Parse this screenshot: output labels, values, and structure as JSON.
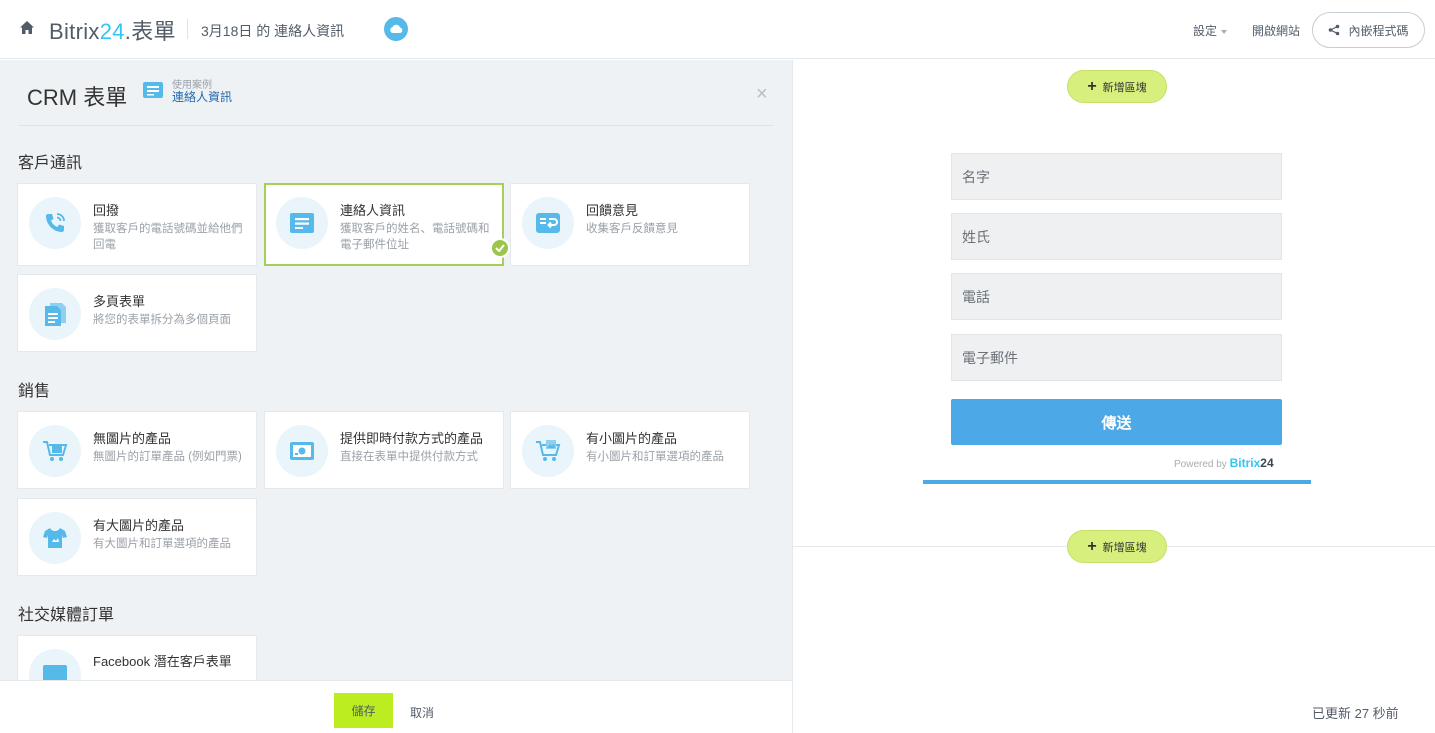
{
  "header": {
    "brand_name": "Bitrix",
    "brand_num": "24",
    "brand_suffix": ".表單",
    "breadcrumb": "3月18日 的 連絡人資訊",
    "settings_label": "設定",
    "open_site_label": "開啟網站",
    "embed_label": "內嵌程式碼"
  },
  "left": {
    "title": "CRM 表單",
    "use_case_label": "使用案例",
    "use_case_value": "連絡人資訊",
    "close_glyph": "×",
    "sections": [
      {
        "title": "客戶通訊",
        "cards": [
          {
            "title": "回撥",
            "desc": "獲取客戶的電話號碼並給他們回電",
            "icon": "phone-call-icon"
          },
          {
            "title": "連絡人資訊",
            "desc": "獲取客戶的姓名、電話號碼和電子郵件位址",
            "icon": "contact-form-icon",
            "selected": true
          },
          {
            "title": "回饋意見",
            "desc": "收集客戶反饋意見",
            "icon": "feedback-icon"
          },
          {
            "title": "多頁表單",
            "desc": "將您的表單拆分為多個頁面",
            "icon": "multipage-icon"
          }
        ]
      },
      {
        "title": "銷售",
        "cards": [
          {
            "title": "無圖片的產品",
            "desc": "無圖片的訂單產品 (例如門票)",
            "icon": "cart-icon"
          },
          {
            "title": "提供即時付款方式的產品",
            "desc": "直接在表單中提供付款方式",
            "icon": "payment-icon"
          },
          {
            "title": "有小圖片的產品",
            "desc": "有小圖片和訂單選項的產品",
            "icon": "cart-image-icon"
          },
          {
            "title": "有大圖片的產品",
            "desc": "有大圖片和訂單選項的產品",
            "icon": "tshirt-icon"
          }
        ]
      },
      {
        "title": "社交媒體訂單",
        "cards": [
          {
            "title": "Facebook 潛在客戶表單",
            "desc": "",
            "icon": "facebook-form-icon"
          }
        ]
      }
    ]
  },
  "bottom": {
    "save_label": "儲存",
    "cancel_label": "取消"
  },
  "preview": {
    "add_block_label": "新增區塊",
    "fields": [
      {
        "placeholder": "名字"
      },
      {
        "placeholder": "姓氏"
      },
      {
        "placeholder": "電話"
      },
      {
        "placeholder": "電子郵件"
      }
    ],
    "submit_label": "傳送",
    "powered_by": "Powered by",
    "powered_brand": "Bitrix",
    "powered_num": "24",
    "updated": "已更新 27 秒前"
  },
  "colors": {
    "accent_blue": "#4ca8e6",
    "accent_green": "#bbed21",
    "brand_cyan": "#2fc6f6",
    "selected_border": "#a5cf5b"
  }
}
